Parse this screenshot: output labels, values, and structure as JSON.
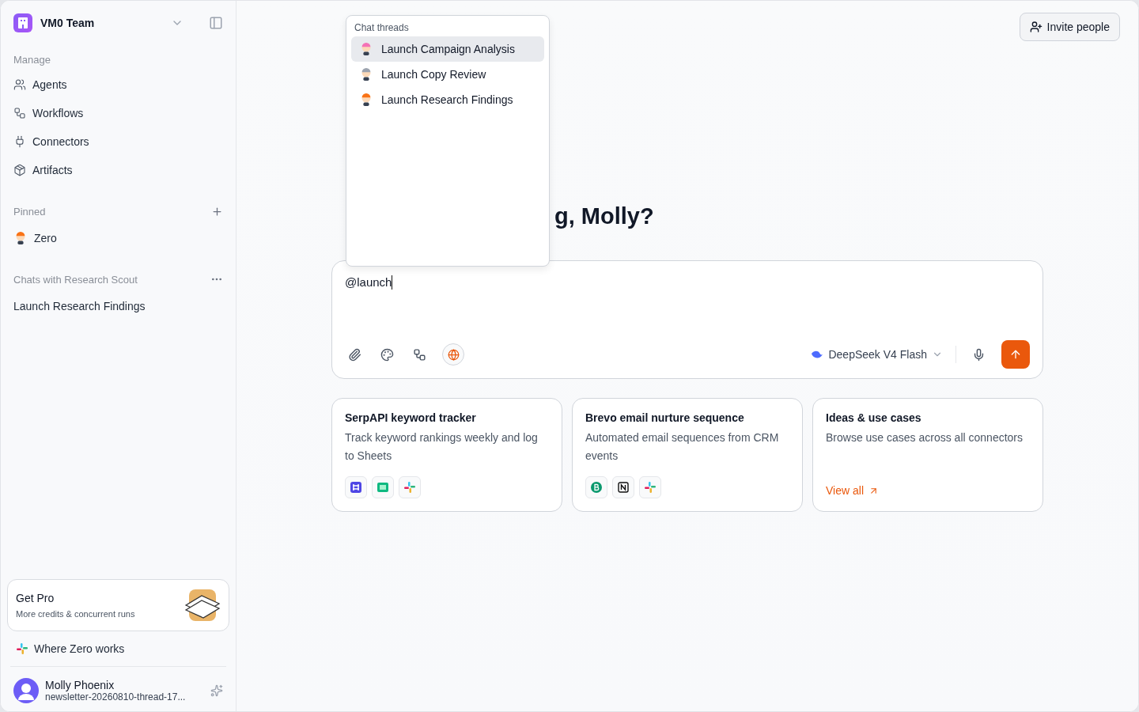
{
  "workspace": {
    "name": "VM0 Team"
  },
  "sidebar": {
    "sections": [
      {
        "title": "Manage",
        "items": [
          {
            "label": "Agents"
          },
          {
            "label": "Workflows"
          },
          {
            "label": "Connectors"
          },
          {
            "label": "Artifacts"
          }
        ]
      },
      {
        "title": "Pinned",
        "items": [
          {
            "label": "Zero",
            "kind": "agent"
          }
        ]
      },
      {
        "title": "Chats with Research Scout",
        "items": [
          {
            "label": "Launch Research Findings",
            "kind": "chat"
          }
        ]
      }
    ],
    "promo": {
      "title": "Get Pro",
      "subtitle": "More credits & concurrent runs"
    },
    "where_link": "Where Zero works",
    "user": {
      "name": "Molly Phoenix",
      "detail": "newsletter-20260810-thread-17..."
    }
  },
  "header": {
    "invite_button": "Invite people"
  },
  "greeting": "g, Molly?",
  "mention_menu": {
    "title": "Chat threads",
    "items": [
      {
        "label": "Launch Campaign Analysis",
        "selected": true,
        "color": "#f472b6"
      },
      {
        "label": "Launch Copy Review",
        "selected": false,
        "color": "#9ca3af"
      },
      {
        "label": "Launch Research Findings",
        "selected": false,
        "color": "#f97316"
      }
    ]
  },
  "composer": {
    "value": "@launch",
    "model": "DeepSeek V4 Flash",
    "web_search": true
  },
  "cards": [
    {
      "kind": "template",
      "title": "SerpAPI keyword tracker",
      "description": "Track keyword rankings weekly and log to Sheets"
    },
    {
      "kind": "template",
      "title": "Brevo email nurture sequence",
      "description": "Automated email sequences from CRM events"
    },
    {
      "kind": "link",
      "title": "Ideas & use cases",
      "description": "Browse use cases across all connectors",
      "link": "View all"
    }
  ]
}
